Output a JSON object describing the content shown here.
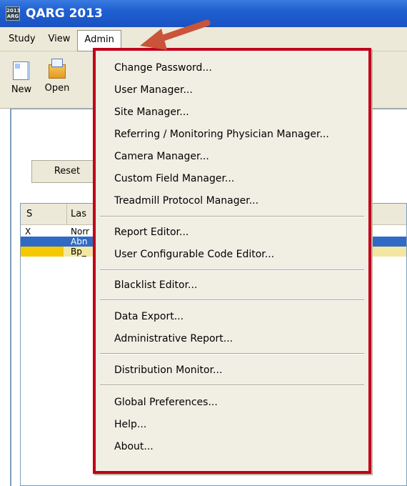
{
  "window": {
    "title": "QARG 2013",
    "icon_top": "2013",
    "icon_bottom": "ARG"
  },
  "menubar": {
    "items": [
      "Study",
      "View",
      "Admin"
    ]
  },
  "toolbar": {
    "new_label": "New",
    "open_label": "Open"
  },
  "content": {
    "reset_label": "Reset",
    "grid_headers": [
      "S",
      "Las"
    ],
    "rows": [
      {
        "c1": "X",
        "c2": "Norr"
      },
      {
        "c1": "",
        "c2": "Abn"
      },
      {
        "c1": "",
        "c2": "Bp_"
      }
    ]
  },
  "admin_menu": {
    "items": [
      "Change Password...",
      "User Manager...",
      "Site Manager...",
      "Referring / Monitoring Physician Manager...",
      "Camera Manager...",
      "Custom Field Manager...",
      "Treadmill Protocol Manager...",
      "Report Editor...",
      "User Configurable Code Editor...",
      "Blacklist Editor...",
      "Data Export...",
      "Administrative Report...",
      "Distribution Monitor...",
      "Global Preferences...",
      "Help...",
      "About..."
    ]
  },
  "colors": {
    "titlebar": "#1f5fd0",
    "highlight_border": "#c0001a",
    "arrow": "#c9543a",
    "selection": "#316ac5"
  },
  "icons": [
    "app-icon",
    "new-document-icon",
    "open-folder-icon",
    "pointer-arrow-icon"
  ]
}
